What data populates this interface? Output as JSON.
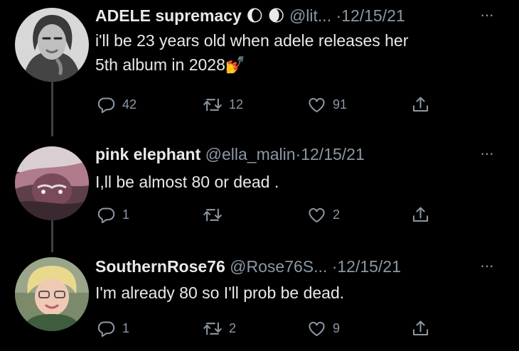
{
  "tweets": [
    {
      "name": "ADELE supremacy",
      "name_emoji": "🌔 🌒",
      "handle": "@lit...",
      "sep": "·",
      "date": "12/15/21",
      "text_line1": "i'll be 23 years old when adele releases her",
      "text_line2": "5th album in 2028",
      "text_emoji": "💅",
      "replies": "42",
      "retweets": "12",
      "likes": "91"
    },
    {
      "name": "pink elephant",
      "handle": "@ella_malin",
      "sep": "·",
      "date": "12/15/21",
      "text_line1": "I,ll be almost 80 or dead .",
      "replies": "1",
      "retweets": "",
      "likes": "2"
    },
    {
      "name": "SouthernRose76",
      "handle": "@Rose76S...",
      "sep": "·",
      "date": "12/15/21",
      "text_line1": "I'm already 80 so I'll prob be dead.",
      "replies": "1",
      "retweets": "2",
      "likes": "9"
    }
  ],
  "more_label": "···",
  "icons": [
    "reply-icon",
    "retweet-icon",
    "like-icon",
    "share-icon",
    "more-icon"
  ]
}
